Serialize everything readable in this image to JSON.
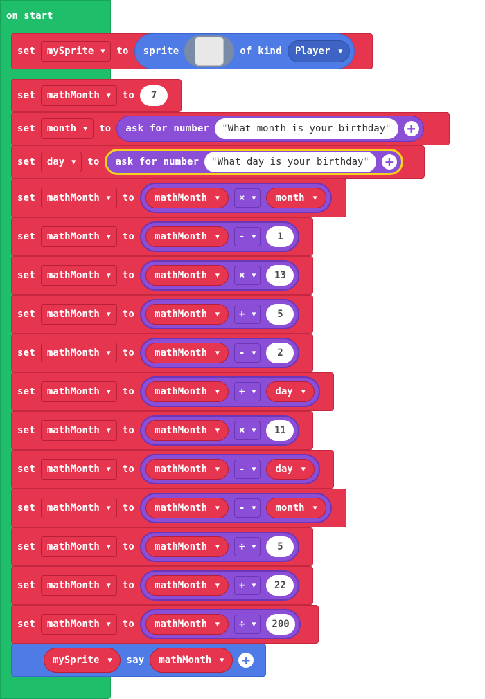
{
  "event": {
    "label": "on start"
  },
  "keywords": {
    "set": "set",
    "to": "to",
    "sprite": "sprite",
    "of_kind": "of kind",
    "ask_for_number": "ask for number",
    "say": "say"
  },
  "line1": {
    "variable": "mySprite",
    "kind": "Player"
  },
  "line2": {
    "variable": "mathMonth",
    "value": "7"
  },
  "line3": {
    "variable": "month",
    "prompt": "What month is your birthday"
  },
  "line4": {
    "variable": "day",
    "prompt": "What day is your birthday"
  },
  "ops": [
    {
      "target": "mathMonth",
      "left": "mathMonth",
      "op": "×",
      "right": "month"
    },
    {
      "target": "mathMonth",
      "left": "mathMonth",
      "op": "-",
      "right": "1"
    },
    {
      "target": "mathMonth",
      "left": "mathMonth",
      "op": "×",
      "right": "13"
    },
    {
      "target": "mathMonth",
      "left": "mathMonth",
      "op": "+",
      "right": "5"
    },
    {
      "target": "mathMonth",
      "left": "mathMonth",
      "op": "-",
      "right": "2"
    },
    {
      "target": "mathMonth",
      "left": "mathMonth",
      "op": "+",
      "right": "day"
    },
    {
      "target": "mathMonth",
      "left": "mathMonth",
      "op": "×",
      "right": "11"
    },
    {
      "target": "mathMonth",
      "left": "mathMonth",
      "op": "-",
      "right": "day"
    },
    {
      "target": "mathMonth",
      "left": "mathMonth",
      "op": "-",
      "right": "month"
    },
    {
      "target": "mathMonth",
      "left": "mathMonth",
      "op": "÷",
      "right": "5"
    },
    {
      "target": "mathMonth",
      "left": "mathMonth",
      "op": "+",
      "right": "22"
    },
    {
      "target": "mathMonth",
      "left": "mathMonth",
      "op": "÷",
      "right": "200"
    }
  ],
  "say_line": {
    "sprite": "mySprite",
    "value": "mathMonth"
  },
  "quote": "\"",
  "caret": "▼",
  "plus": "+",
  "colors": {
    "event": "#1fbe6a",
    "variables": "#e6354f",
    "sprites": "#4e7be6",
    "math": "#8a4fd6",
    "selection": "#f7d11e"
  }
}
